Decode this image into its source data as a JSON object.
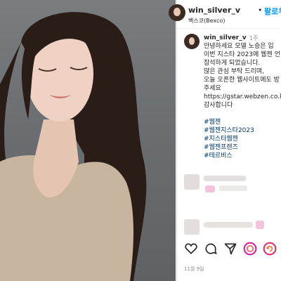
{
  "header": {
    "username": "win_silver_v",
    "separator": "•",
    "follow_label": "팔로우",
    "location": "벡스코(Bexco)"
  },
  "caption": {
    "username": "win_silver_v",
    "time": "1주",
    "lines": [
      "안녕하세요 모델 노승은 입",
      "이번 지스타 2023에 웹젠 언",
      "참석하게 되었습니다.",
      "많은 관심 부탁 드리며,",
      "오늘 오픈한 웹사이트에도 방",
      "주세요",
      "https://gstar.webzen.co.kr/",
      "감사합니다"
    ],
    "hashtags": [
      "#웹젠",
      "#웹젠지스타2023",
      "#지스타웹젠",
      "#웹젠프렌즈",
      "#테르비스"
    ]
  },
  "actions": [
    "heart-icon",
    "comment-icon",
    "share-icon",
    "story-icon",
    "refresh-icon"
  ],
  "date": "11월 9일",
  "colors": {
    "link": "#0095f6",
    "hashtag": "#00376b",
    "muted": "#8e8e8e"
  }
}
